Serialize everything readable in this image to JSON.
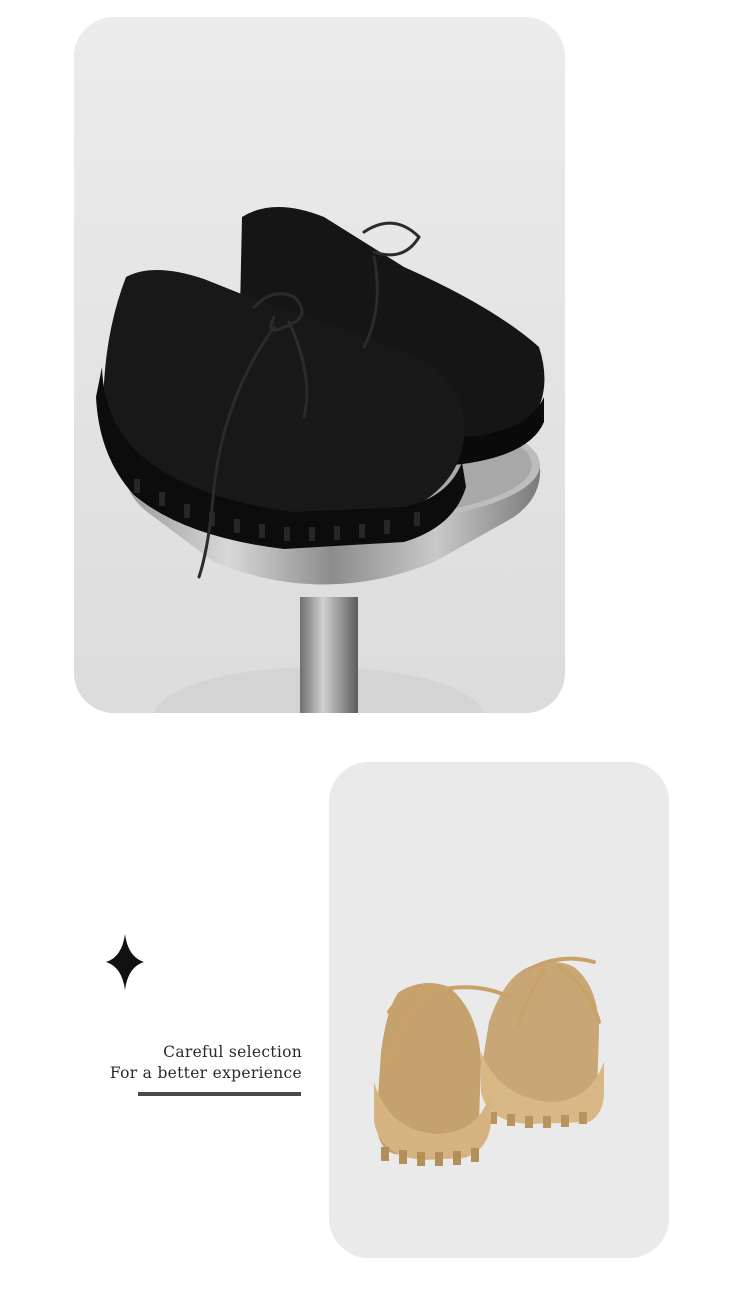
{
  "tagline": {
    "line1": "Careful selection",
    "line2": "For a better experience"
  },
  "colors": {
    "card_background": "#e9e9e9",
    "black_shoe": "#111111",
    "tan_shoe": "#c9a77a",
    "accent_line": "#4a4a4a"
  },
  "icons": {
    "decoration": "four-point-star-icon"
  }
}
